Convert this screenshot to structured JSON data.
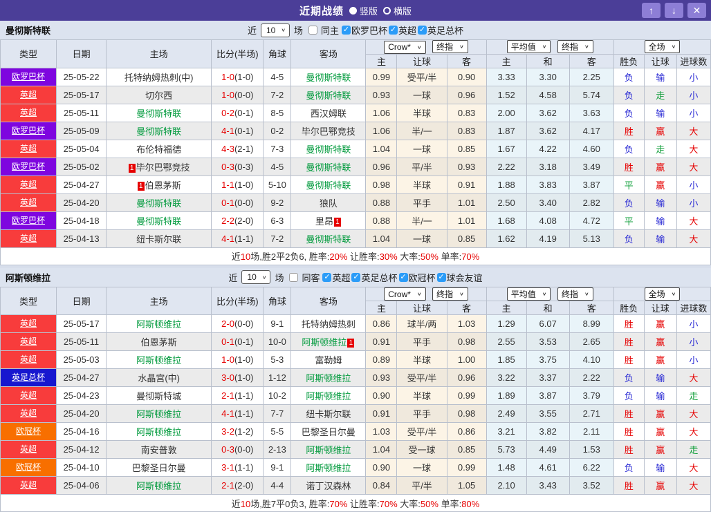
{
  "titlebar": {
    "title": "近期战绩",
    "radios": [
      {
        "label": "竖版",
        "selected": true
      },
      {
        "label": "横版",
        "selected": false
      }
    ],
    "buttons": [
      {
        "name": "move-up",
        "glyph": "↑"
      },
      {
        "name": "move-down",
        "glyph": "↓"
      },
      {
        "name": "close",
        "glyph": "✕"
      }
    ]
  },
  "filter_common": {
    "near": "近",
    "count": "10",
    "games": "场"
  },
  "table_header": {
    "cols": [
      "类型",
      "日期",
      "主场",
      "比分(半场)",
      "角球",
      "客场"
    ],
    "sub": [
      "主",
      "让球",
      "客",
      "主",
      "和",
      "客",
      "胜负",
      "让球",
      "进球数"
    ],
    "selects": {
      "crow": "Crow*",
      "final": "终指",
      "avg": "平均值",
      "scope": "全场"
    }
  },
  "type_colors": {
    "英超": "#f83c3c",
    "欧罗巴杯": "#7e06df",
    "英足总杯": "#1717cf",
    "欧冠杯": "#f86f00"
  },
  "result_colors": {
    "胜": "#e60000",
    "赢": "#e60000",
    "大": "#e60000",
    "负": "#2929d4",
    "输": "#2929d4",
    "小": "#2929d4",
    "平": "#13a03c",
    "走": "#13a03c"
  },
  "red_card_text": "1",
  "sections": [
    {
      "team": "曼彻斯特联",
      "same_label": "同主",
      "same_checked": false,
      "leagues": [
        "欧罗巴杯",
        "英超",
        "英足总杯"
      ],
      "rows": [
        {
          "type": "欧罗巴杯",
          "date": "25-05-22",
          "home": {
            "n": "托特纳姆热刺(中)"
          },
          "ft": "1-0",
          "ht": "(1-0)",
          "corner": "4-5",
          "away": {
            "n": "曼彻斯特联",
            "g": 1
          },
          "o1": "0.99",
          "hc": "受平/半",
          "o2": "0.90",
          "a1": "3.33",
          "a2": "3.30",
          "a3": "2.25",
          "res": [
            "负",
            "输",
            "小"
          ]
        },
        {
          "type": "英超",
          "date": "25-05-17",
          "home": {
            "n": "切尔西"
          },
          "ft": "1-0",
          "ht": "(0-0)",
          "corner": "7-2",
          "away": {
            "n": "曼彻斯特联",
            "g": 1
          },
          "o1": "0.93",
          "hc": "一球",
          "o2": "0.96",
          "a1": "1.52",
          "a2": "4.58",
          "a3": "5.74",
          "res": [
            "负",
            "走",
            "小"
          ]
        },
        {
          "type": "英超",
          "date": "25-05-11",
          "home": {
            "n": "曼彻斯特联",
            "g": 1
          },
          "ft": "0-2",
          "ht": "(0-1)",
          "corner": "8-5",
          "away": {
            "n": "西汉姆联"
          },
          "o1": "1.06",
          "hc": "半球",
          "o2": "0.83",
          "a1": "2.00",
          "a2": "3.62",
          "a3": "3.63",
          "res": [
            "负",
            "输",
            "小"
          ]
        },
        {
          "type": "欧罗巴杯",
          "date": "25-05-09",
          "home": {
            "n": "曼彻斯特联",
            "g": 1
          },
          "ft": "4-1",
          "ht": "(0-1)",
          "corner": "0-2",
          "away": {
            "n": "毕尔巴鄂竞技"
          },
          "o1": "1.06",
          "hc": "半/一",
          "o2": "0.83",
          "a1": "1.87",
          "a2": "3.62",
          "a3": "4.17",
          "res": [
            "胜",
            "赢",
            "大"
          ]
        },
        {
          "type": "英超",
          "date": "25-05-04",
          "home": {
            "n": "布伦特福德"
          },
          "ft": "4-3",
          "ht": "(2-1)",
          "corner": "7-3",
          "away": {
            "n": "曼彻斯特联",
            "g": 1
          },
          "o1": "1.04",
          "hc": "一球",
          "o2": "0.85",
          "a1": "1.67",
          "a2": "4.22",
          "a3": "4.60",
          "res": [
            "负",
            "走",
            "大"
          ]
        },
        {
          "type": "欧罗巴杯",
          "date": "25-05-02",
          "home": {
            "n": "毕尔巴鄂竞技",
            "card": "before"
          },
          "ft": "0-3",
          "ht": "(0-3)",
          "corner": "4-5",
          "away": {
            "n": "曼彻斯特联",
            "g": 1
          },
          "o1": "0.96",
          "hc": "平/半",
          "o2": "0.93",
          "a1": "2.22",
          "a2": "3.18",
          "a3": "3.49",
          "res": [
            "胜",
            "赢",
            "大"
          ]
        },
        {
          "type": "英超",
          "date": "25-04-27",
          "home": {
            "n": "伯恩茅斯",
            "card": "before"
          },
          "ft": "1-1",
          "ht": "(1-0)",
          "corner": "5-10",
          "away": {
            "n": "曼彻斯特联",
            "g": 1
          },
          "o1": "0.98",
          "hc": "半球",
          "o2": "0.91",
          "a1": "1.88",
          "a2": "3.83",
          "a3": "3.87",
          "res": [
            "平",
            "赢",
            "小"
          ]
        },
        {
          "type": "英超",
          "date": "25-04-20",
          "home": {
            "n": "曼彻斯特联",
            "g": 1
          },
          "ft": "0-1",
          "ht": "(0-0)",
          "corner": "9-2",
          "away": {
            "n": "狼队"
          },
          "o1": "0.88",
          "hc": "平手",
          "o2": "1.01",
          "a1": "2.50",
          "a2": "3.40",
          "a3": "2.82",
          "res": [
            "负",
            "输",
            "小"
          ]
        },
        {
          "type": "欧罗巴杯",
          "date": "25-04-18",
          "home": {
            "n": "曼彻斯特联",
            "g": 1
          },
          "ft": "2-2",
          "ht": "(2-0)",
          "corner": "6-3",
          "away": {
            "n": "里昂",
            "card": "after"
          },
          "o1": "0.88",
          "hc": "半/一",
          "o2": "1.01",
          "a1": "1.68",
          "a2": "4.08",
          "a3": "4.72",
          "res": [
            "平",
            "输",
            "大"
          ]
        },
        {
          "type": "英超",
          "date": "25-04-13",
          "home": {
            "n": "纽卡斯尔联"
          },
          "ft": "4-1",
          "ht": "(1-1)",
          "corner": "7-2",
          "away": {
            "n": "曼彻斯特联",
            "g": 1
          },
          "o1": "1.04",
          "hc": "一球",
          "o2": "0.85",
          "a1": "1.62",
          "a2": "4.19",
          "a3": "5.13",
          "res": [
            "负",
            "输",
            "大"
          ]
        }
      ],
      "summary": [
        [
          "近",
          0
        ],
        [
          "10",
          1
        ],
        [
          "场,胜2平2负6, 胜率:",
          0
        ],
        [
          "20%",
          1
        ],
        [
          " 让胜率:",
          0
        ],
        [
          "30%",
          1
        ],
        [
          " 大率:",
          0
        ],
        [
          "50%",
          1
        ],
        [
          " 单率:",
          0
        ],
        [
          "70%",
          1
        ]
      ]
    },
    {
      "team": "阿斯顿维拉",
      "same_label": "同客",
      "same_checked": false,
      "leagues": [
        "英超",
        "英足总杯",
        "欧冠杯",
        "球会友谊"
      ],
      "rows": [
        {
          "type": "英超",
          "date": "25-05-17",
          "home": {
            "n": "阿斯顿维拉",
            "g": 1
          },
          "ft": "2-0",
          "ht": "(0-0)",
          "corner": "9-1",
          "away": {
            "n": "托特纳姆热刺"
          },
          "o1": "0.86",
          "hc": "球半/两",
          "o2": "1.03",
          "a1": "1.29",
          "a2": "6.07",
          "a3": "8.99",
          "res": [
            "胜",
            "赢",
            "小"
          ]
        },
        {
          "type": "英超",
          "date": "25-05-11",
          "home": {
            "n": "伯恩茅斯"
          },
          "ft": "0-1",
          "ht": "(0-1)",
          "corner": "10-0",
          "away": {
            "n": "阿斯顿维拉",
            "g": 1,
            "card": "after"
          },
          "o1": "0.91",
          "hc": "平手",
          "o2": "0.98",
          "a1": "2.55",
          "a2": "3.53",
          "a3": "2.65",
          "res": [
            "胜",
            "赢",
            "小"
          ]
        },
        {
          "type": "英超",
          "date": "25-05-03",
          "home": {
            "n": "阿斯顿维拉",
            "g": 1
          },
          "ft": "1-0",
          "ht": "(1-0)",
          "corner": "5-3",
          "away": {
            "n": "富勒姆"
          },
          "o1": "0.89",
          "hc": "半球",
          "o2": "1.00",
          "a1": "1.85",
          "a2": "3.75",
          "a3": "4.10",
          "res": [
            "胜",
            "赢",
            "小"
          ]
        },
        {
          "type": "英足总杯",
          "date": "25-04-27",
          "home": {
            "n": "水晶宫(中)"
          },
          "ft": "3-0",
          "ht": "(1-0)",
          "corner": "1-12",
          "away": {
            "n": "阿斯顿维拉",
            "g": 1
          },
          "o1": "0.93",
          "hc": "受平/半",
          "o2": "0.96",
          "a1": "3.22",
          "a2": "3.37",
          "a3": "2.22",
          "res": [
            "负",
            "输",
            "大"
          ]
        },
        {
          "type": "英超",
          "date": "25-04-23",
          "home": {
            "n": "曼彻斯特城"
          },
          "ft": "2-1",
          "ht": "(1-1)",
          "corner": "10-2",
          "away": {
            "n": "阿斯顿维拉",
            "g": 1
          },
          "o1": "0.90",
          "hc": "半球",
          "o2": "0.99",
          "a1": "1.89",
          "a2": "3.87",
          "a3": "3.79",
          "res": [
            "负",
            "输",
            "走"
          ]
        },
        {
          "type": "英超",
          "date": "25-04-20",
          "home": {
            "n": "阿斯顿维拉",
            "g": 1
          },
          "ft": "4-1",
          "ht": "(1-1)",
          "corner": "7-7",
          "away": {
            "n": "纽卡斯尔联"
          },
          "o1": "0.91",
          "hc": "平手",
          "o2": "0.98",
          "a1": "2.49",
          "a2": "3.55",
          "a3": "2.71",
          "res": [
            "胜",
            "赢",
            "大"
          ]
        },
        {
          "type": "欧冠杯",
          "date": "25-04-16",
          "home": {
            "n": "阿斯顿维拉",
            "g": 1
          },
          "ft": "3-2",
          "ht": "(1-2)",
          "corner": "5-5",
          "away": {
            "n": "巴黎圣日尔曼"
          },
          "o1": "1.03",
          "hc": "受平/半",
          "o2": "0.86",
          "a1": "3.21",
          "a2": "3.82",
          "a3": "2.11",
          "res": [
            "胜",
            "赢",
            "大"
          ]
        },
        {
          "type": "英超",
          "date": "25-04-12",
          "home": {
            "n": "南安普敦"
          },
          "ft": "0-3",
          "ht": "(0-0)",
          "corner": "2-13",
          "away": {
            "n": "阿斯顿维拉",
            "g": 1
          },
          "o1": "1.04",
          "hc": "受一球",
          "o2": "0.85",
          "a1": "5.73",
          "a2": "4.49",
          "a3": "1.53",
          "res": [
            "胜",
            "赢",
            "走"
          ]
        },
        {
          "type": "欧冠杯",
          "date": "25-04-10",
          "home": {
            "n": "巴黎圣日尔曼"
          },
          "ft": "3-1",
          "ht": "(1-1)",
          "corner": "9-1",
          "away": {
            "n": "阿斯顿维拉",
            "g": 1
          },
          "o1": "0.90",
          "hc": "一球",
          "o2": "0.99",
          "a1": "1.48",
          "a2": "4.61",
          "a3": "6.22",
          "res": [
            "负",
            "输",
            "大"
          ]
        },
        {
          "type": "英超",
          "date": "25-04-06",
          "home": {
            "n": "阿斯顿维拉",
            "g": 1
          },
          "ft": "2-1",
          "ht": "(2-0)",
          "corner": "4-4",
          "away": {
            "n": "诺丁汉森林"
          },
          "o1": "0.84",
          "hc": "平/半",
          "o2": "1.05",
          "a1": "2.10",
          "a2": "3.43",
          "a3": "3.52",
          "res": [
            "胜",
            "赢",
            "大"
          ]
        }
      ],
      "summary": [
        [
          "近",
          0
        ],
        [
          "10",
          1
        ],
        [
          "场,胜7平0负3, 胜率:",
          0
        ],
        [
          "70%",
          1
        ],
        [
          " 让胜率:",
          0
        ],
        [
          "70%",
          1
        ],
        [
          " 大率:",
          0
        ],
        [
          "50%",
          1
        ],
        [
          " 单率:",
          0
        ],
        [
          "80%",
          1
        ]
      ]
    }
  ]
}
